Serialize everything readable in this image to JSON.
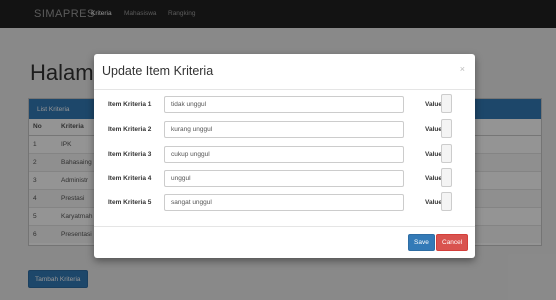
{
  "navbar": {
    "brand": "SIMAPRES",
    "links": [
      "Kriteria",
      "Mahasiswa",
      "Rangking"
    ]
  },
  "page": {
    "heading": "Halaman",
    "panel_title": "List Kriteria",
    "columns": [
      "No",
      "Kriteria"
    ],
    "rows": [
      {
        "no": "1",
        "kriteria": "IPK"
      },
      {
        "no": "2",
        "kriteria": "Bahasaing"
      },
      {
        "no": "3",
        "kriteria": "Administr"
      },
      {
        "no": "4",
        "kriteria": "Prestasi"
      },
      {
        "no": "5",
        "kriteria": "Karyatmah"
      },
      {
        "no": "6",
        "kriteria": "Presentasi"
      }
    ],
    "tambah_label": "Tambah Kriteria"
  },
  "modal": {
    "title": "Update Item Kriteria",
    "close": "×",
    "value_label": "Value",
    "items": [
      {
        "label": "Item Kriteria 1",
        "value": "tidak unggul"
      },
      {
        "label": "Item Kriteria 2",
        "value": "kurang unggul"
      },
      {
        "label": "Item Kriteria 3",
        "value": "cukup unggul"
      },
      {
        "label": "Item Kriteria 4",
        "value": "unggul"
      },
      {
        "label": "Item Kriteria 5",
        "value": "sangat unggul"
      }
    ],
    "save_label": "Save",
    "cancel_label": "Cancel"
  },
  "colors": {
    "primary": "#337ab7",
    "danger": "#d9534f",
    "navbar": "#222222"
  }
}
